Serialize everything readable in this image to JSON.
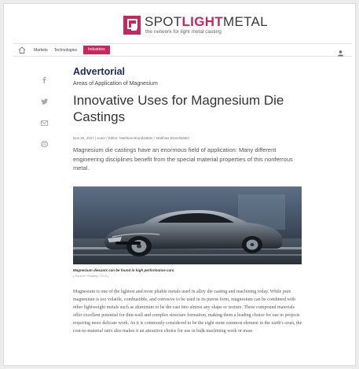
{
  "site": {
    "logo_word_plain": "SPOT",
    "logo_word_accent": "LIGHT",
    "logo_word_tail": "METAL",
    "tagline": "the network for light metal casting",
    "brand_color": "#c6285b"
  },
  "nav": {
    "items": [
      {
        "label": "Markets"
      },
      {
        "label": "Technologies"
      },
      {
        "label": "Industries"
      }
    ],
    "active_index": 2
  },
  "share": {
    "icons": [
      "facebook-icon",
      "twitter-icon",
      "email-icon",
      "print-icon"
    ]
  },
  "article": {
    "kicker": "Advertorial",
    "subtitle": "Areas of Application of Magnesium",
    "title": "Innovative Uses for Magnesium Die Castings",
    "byline": "Nov 26, 2017 | Autor / Editor: Matthias Brandstätter / Matthias Brandstätter",
    "lead": "Magnesium die castings have an enormous field of application: Many different engineering disciplines benefit from the special material properties of this nonferrous metal.",
    "caption": "Magnesium diecasts can be found in high performance cars.",
    "credit": "( Source: Pixabay / CC0 )",
    "body": "Magnesium is one of the lightest and most pliable metals used in alloy die casting and machining today. While pure magnesium is too volatile, combustible, and corrosive to be used in its purest form, magnesium can be combined with other lightweight metals such as aluminum to be die cast into almost any shape or texture. These compound materials offer excellent potential for thin-wall and complex structure formation, making them a leading choice for use in projects requiring more delicate work. As it is commonly considered to be the eight most common element in the earth's crust, the cost-to-material ratio also makes it an attractive choice for use in bulk machining work or mass"
  }
}
